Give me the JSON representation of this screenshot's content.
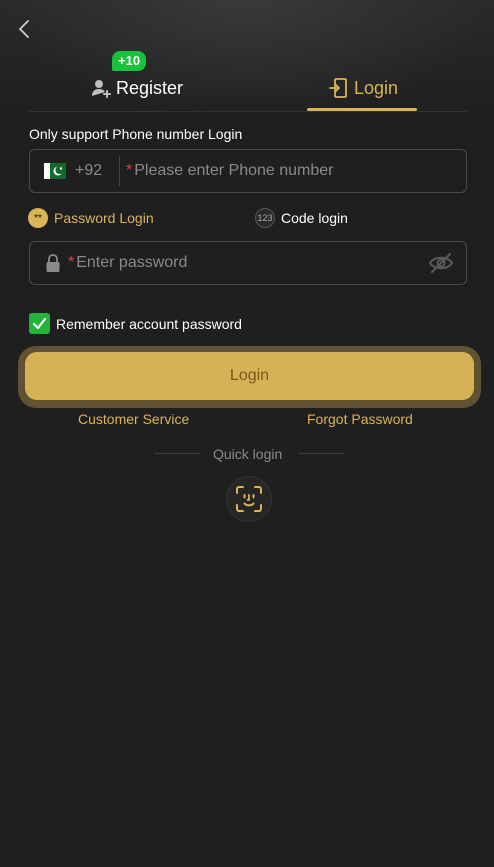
{
  "tabs": {
    "register_label": "Register",
    "register_badge": "+10",
    "login_label": "Login"
  },
  "hint": "Only support Phone number Login",
  "phone": {
    "country_code": "+92",
    "required_mark": "*",
    "placeholder": "Please enter Phone number"
  },
  "modes": {
    "password_label": "Password Login",
    "password_icon_text": "**",
    "code_label": "Code login",
    "code_icon_text": "123"
  },
  "password": {
    "required_mark": "*",
    "placeholder": "Enter password"
  },
  "remember_label": "Remember account password",
  "login_button": "Login",
  "links": {
    "customer_service": "Customer Service",
    "forgot_password": "Forgot Password"
  },
  "quick_login_label": "Quick login",
  "colors": {
    "background": "#1f1f1f",
    "accent": "#d9b459",
    "button": "#d5b256",
    "check": "#22b43a",
    "badge": "#18c23a"
  },
  "icons": {
    "back": "chevron-left-icon",
    "register": "add-user-icon",
    "login": "door-enter-icon",
    "lock": "lock-icon",
    "eye": "eye-off-icon",
    "check": "check-icon",
    "face": "face-id-icon",
    "flag": "pakistan-flag-icon"
  }
}
